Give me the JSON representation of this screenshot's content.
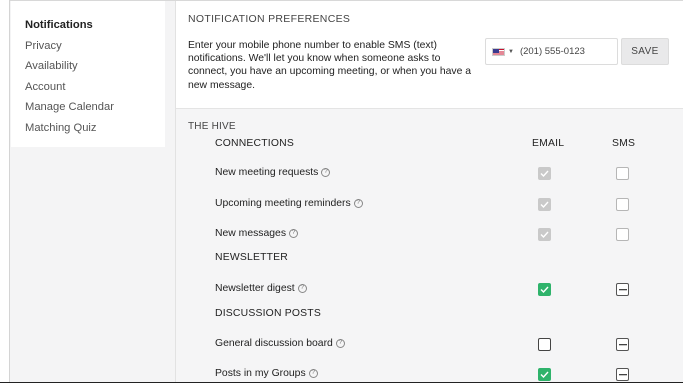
{
  "sidebar": {
    "items": [
      {
        "label": "Notifications",
        "active": true
      },
      {
        "label": "Privacy",
        "active": false
      },
      {
        "label": "Availability",
        "active": false
      },
      {
        "label": "Account",
        "active": false
      },
      {
        "label": "Manage Calendar",
        "active": false
      },
      {
        "label": "Matching Quiz",
        "active": false
      }
    ]
  },
  "main": {
    "heading": "NOTIFICATION PREFERENCES",
    "intro": "Enter your mobile phone number to enable SMS (text) notifications. We'll let you know when someone asks to connect, you have an upcoming meeting, or when you have a new message.",
    "phone": {
      "flag_icon": "us-flag-icon",
      "placeholder": "(201) 555-0123",
      "value": ""
    },
    "save_label": "SAVE"
  },
  "prefs": {
    "group": "THE HIVE",
    "columns": {
      "email": "EMAIL",
      "sms": "SMS"
    },
    "sections": [
      {
        "title": "CONNECTIONS",
        "rows": [
          {
            "label": "New meeting requests",
            "email": "checked-disabled",
            "sms": "unchecked-disabled"
          },
          {
            "label": "Upcoming meeting reminders",
            "email": "checked-disabled",
            "sms": "unchecked-disabled"
          },
          {
            "label": "New messages",
            "email": "checked-disabled",
            "sms": "unchecked-disabled"
          }
        ]
      },
      {
        "title": "NEWSLETTER",
        "rows": [
          {
            "label": "Newsletter digest",
            "email": "checked",
            "sms": "indeterminate"
          }
        ]
      },
      {
        "title": "DISCUSSION POSTS",
        "rows": [
          {
            "label": "General discussion board",
            "email": "unchecked",
            "sms": "indeterminate"
          },
          {
            "label": "Posts in my Groups",
            "email": "checked",
            "sms": "indeterminate"
          }
        ]
      }
    ],
    "help_icon": "question-circle-icon",
    "colors": {
      "green": "#2fb36b",
      "disabled": "#c9c9c9"
    }
  }
}
